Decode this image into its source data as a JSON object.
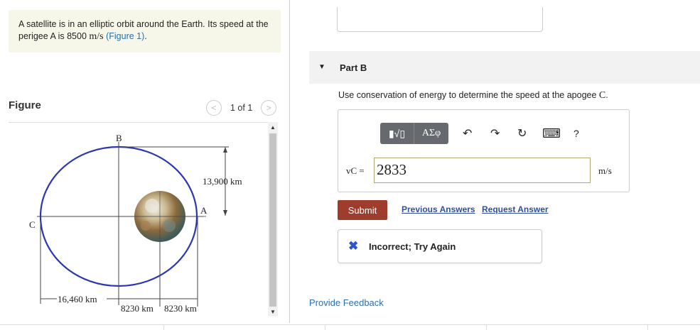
{
  "problem": {
    "text_before": "A satellite is in an elliptic orbit around the Earth. Its speed at the perigee A is 8500 ",
    "unit": "m/s",
    "link": "(Figure 1)",
    "text_after": "."
  },
  "figure": {
    "title": "Figure",
    "pager_text": "1 of 1",
    "labels": {
      "B": "B",
      "C": "C",
      "A": "A",
      "height": "13,900 km",
      "left_dist": "16,460 km",
      "mid_dist_1": "8230 km",
      "mid_dist_2": "8230 km"
    },
    "colors": {
      "orbit": "#2b35b5"
    }
  },
  "part_b": {
    "label": "Part B",
    "question_prefix": "Use conservation of energy to determine the speed at the apogee ",
    "question_var": "C",
    "question_suffix": "."
  },
  "toolbar": {
    "templates": "▮√▯",
    "greek": "AΣφ",
    "undo": "↶",
    "redo": "↷",
    "reset": "↻",
    "keyboard": "⌨",
    "help": "?"
  },
  "answer": {
    "variable_label": "vC =",
    "value": "2833",
    "units": "m/s"
  },
  "actions": {
    "submit": "Submit",
    "previous_answers": "Previous Answers",
    "request_answer": "Request Answer"
  },
  "feedback": {
    "icon": "✖",
    "text": "Incorrect; Try Again"
  },
  "provide_feedback": "Provide Feedback"
}
